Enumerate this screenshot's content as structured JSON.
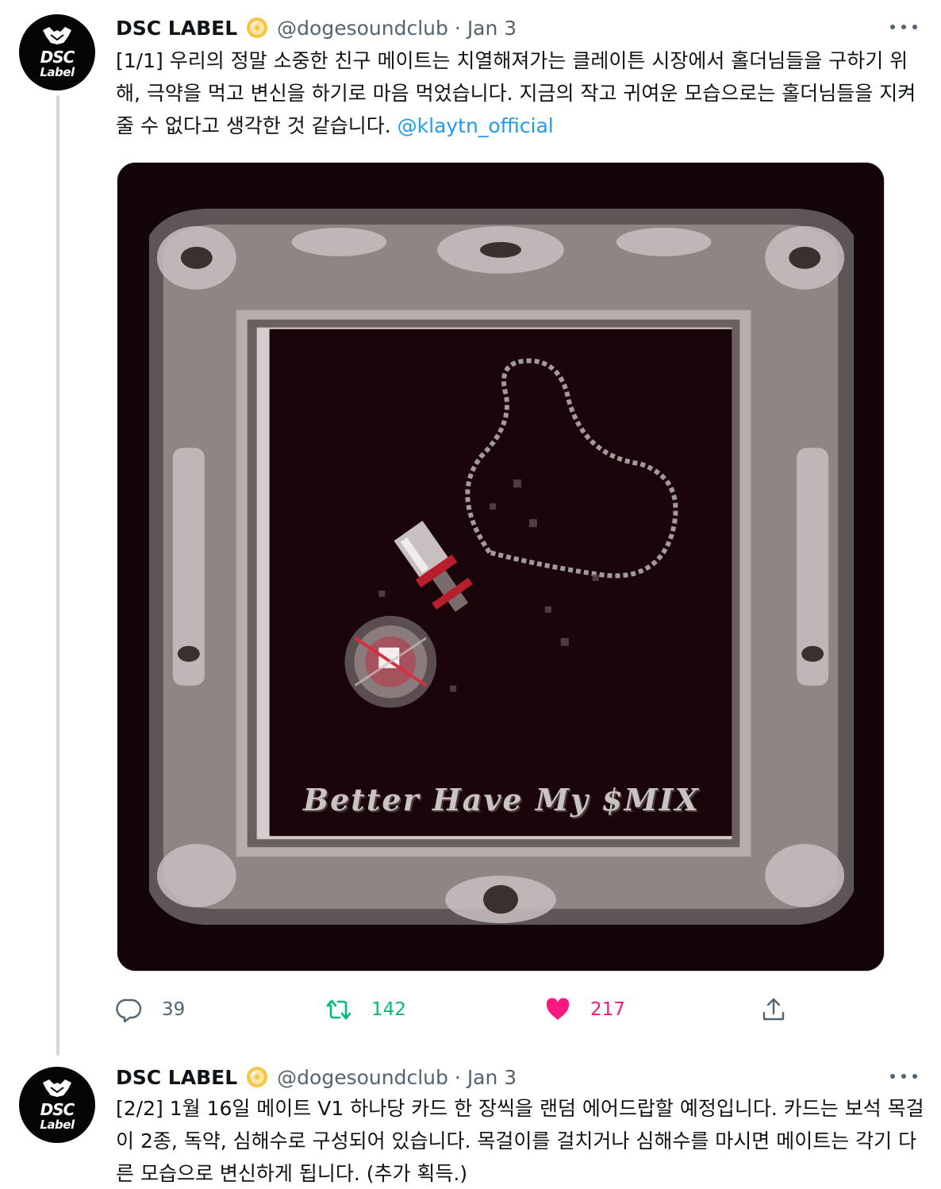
{
  "tweets": [
    {
      "author_name": "DSC LABEL",
      "handle": "@dogesoundclub",
      "separator": "·",
      "time": "Jan 3",
      "avatar_text_1": "DSC",
      "avatar_text_2": "Label",
      "text": "[1/1] 우리의 정말 소중한 친구 메이트는 치열해져가는 클레이튼 시장에서 홀더님들을 구하기 위해, 극약을 먹고 변신을 하기로 마음 먹었습니다. 지금의 작고 귀여운 모습으로는 홀더님들을 지켜줄 수 없다고 생각한 것 같습니다.",
      "mention": "@klaytn_official",
      "media_caption": "Better Have My $MIX",
      "reply_count": "39",
      "retweet_count": "142",
      "like_count": "217"
    },
    {
      "author_name": "DSC LABEL",
      "handle": "@dogesoundclub",
      "separator": "·",
      "time": "Jan 3",
      "avatar_text_1": "DSC",
      "avatar_text_2": "Label",
      "text": "[2/2] 1월 16일 메이트 V1 하나당 카드 한 장씩을 랜덤 에어드랍할 예정입니다. 카드는 보석 목걸이 2종, 독약, 심해수로 구성되어 있습니다. 목걸이를 걸치거나 심해수를 마시면 메이트는 각기 다른 모습으로 변신하게 됩니다. (추가 획득.)"
    }
  ],
  "icons": {
    "badge": "verified-gold-badge-icon",
    "more": "more-options-icon",
    "reply": "reply-bubble-icon",
    "retweet": "retweet-icon",
    "like": "heart-filled-icon",
    "share": "share-upload-icon"
  },
  "colors": {
    "text": "#0f1419",
    "secondary": "#536471",
    "link": "#1d9bf0",
    "retweet": "#00ba7c",
    "like": "#f91880",
    "thread_line": "#cfd9de"
  }
}
